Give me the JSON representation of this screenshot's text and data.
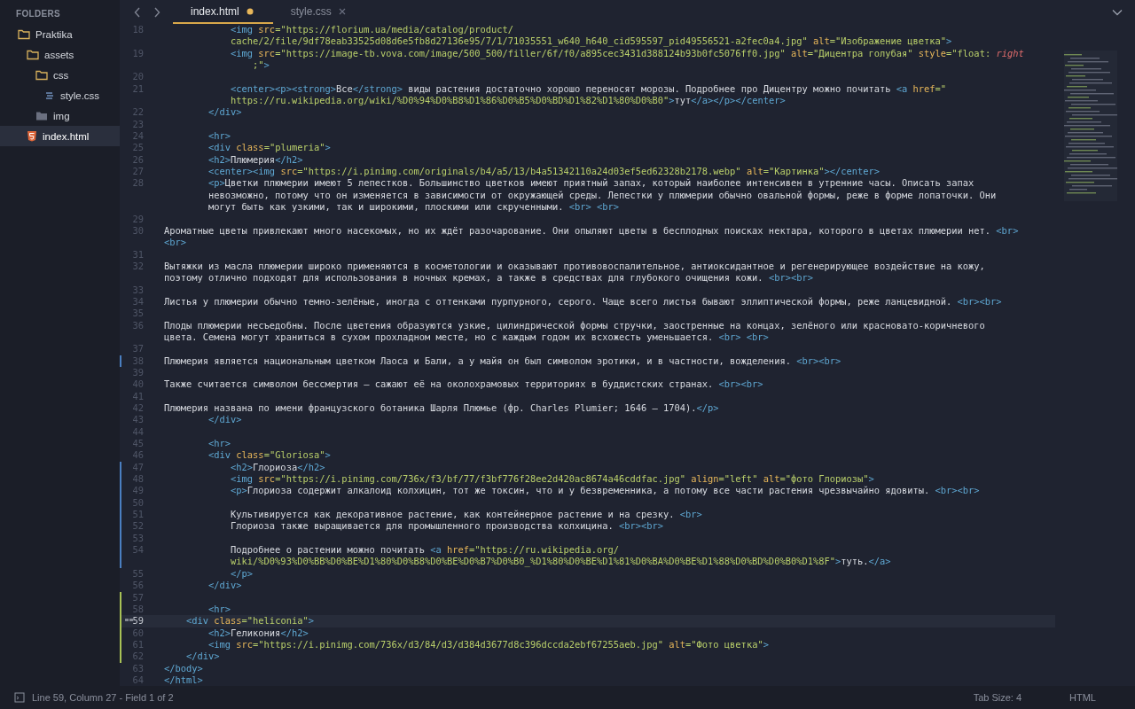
{
  "sidebar": {
    "title": "FOLDERS",
    "tree": [
      {
        "label": "Praktika",
        "kind": "folder",
        "expanded": true,
        "selected": false,
        "children": [
          {
            "label": "assets",
            "kind": "folder",
            "expanded": true,
            "selected": false,
            "children": [
              {
                "label": "css",
                "kind": "folder",
                "expanded": true,
                "selected": false,
                "children": [
                  {
                    "label": "style.css",
                    "kind": "css",
                    "selected": false
                  }
                ]
              },
              {
                "label": "img",
                "kind": "folder",
                "expanded": false,
                "selected": false
              }
            ]
          },
          {
            "label": "index.html",
            "kind": "html",
            "selected": true
          }
        ]
      }
    ]
  },
  "tabs": [
    {
      "label": "index.html",
      "selected": true,
      "modified": true
    },
    {
      "label": "style.css",
      "selected": false,
      "modified": false
    }
  ],
  "lines": [
    {
      "number": "18",
      "modified": false,
      "added": false,
      "current": false,
      "rows": [
        {
          "spans": [
            {
              "kind": "tag",
              "text": "            <img"
            },
            {
              "kind": "attr",
              "text": " src"
            },
            {
              "kind": "string",
              "text": "=\"https://florium.ua/media/catalog/product/"
            }
          ]
        },
        {
          "spans": [
            {
              "kind": "string",
              "text": "            cache/2/file/9df78eab33525d08d6e5fb8d27136e95/7/1/71035551_w640_h640_cid595597_pid49556521-a2fec0a4.jpg\""
            },
            {
              "kind": "attr",
              "text": " alt"
            },
            {
              "kind": "string",
              "text": "=\"Изображение цветка\""
            },
            {
              "kind": "tag",
              "text": ">"
            }
          ]
        }
      ]
    },
    {
      "number": "19",
      "modified": false,
      "added": false,
      "current": false,
      "rows": [
        {
          "spans": [
            {
              "kind": "tag",
              "text": "            <img"
            },
            {
              "kind": "attr",
              "text": " src"
            },
            {
              "kind": "string",
              "text": "=\"https://image-tb.vova.com/image/500_500/filler/6f/f0/a895cec3431d388124b93b0fc5076ff0.jpg\""
            },
            {
              "kind": "attr",
              "text": " alt"
            },
            {
              "kind": "string",
              "text": "=\"Дицентра голубая\""
            },
            {
              "kind": "attr",
              "text": " style"
            },
            {
              "kind": "string",
              "text": "=\"float: "
            },
            {
              "kind": "keyword",
              "text": "right"
            }
          ]
        },
        {
          "spans": [
            {
              "kind": "string",
              "text": "                ;\""
            },
            {
              "kind": "tag",
              "text": ">"
            }
          ]
        }
      ]
    },
    {
      "number": "20",
      "modified": false,
      "added": false,
      "current": false,
      "rows": [
        {
          "spans": []
        }
      ]
    },
    {
      "number": "21",
      "modified": false,
      "added": false,
      "current": false,
      "rows": [
        {
          "spans": [
            {
              "kind": "tag",
              "text": "            <center><p><strong>"
            },
            {
              "kind": "text",
              "text": "Все"
            },
            {
              "kind": "tag",
              "text": "</strong>"
            },
            {
              "kind": "text",
              "text": " виды растения достаточно хорошо переносят морозы. Подробнее про Дицентру можно почитать "
            },
            {
              "kind": "tag",
              "text": "<a"
            },
            {
              "kind": "attr",
              "text": " href"
            },
            {
              "kind": "string",
              "text": "=\""
            }
          ]
        },
        {
          "spans": [
            {
              "kind": "string",
              "text": "            https://ru.wikipedia.org/wiki/%D0%94%D0%B8%D1%86%D0%B5%D0%BD%D1%82%D1%80%D0%B0\""
            },
            {
              "kind": "tag",
              "text": ">"
            },
            {
              "kind": "text",
              "text": "тут"
            },
            {
              "kind": "tag",
              "text": "</a></p></center>"
            }
          ]
        }
      ]
    },
    {
      "number": "22",
      "modified": false,
      "added": false,
      "current": false,
      "rows": [
        {
          "spans": [
            {
              "kind": "tag",
              "text": "        </div>"
            }
          ]
        }
      ]
    },
    {
      "number": "23",
      "modified": false,
      "added": false,
      "current": false,
      "rows": [
        {
          "spans": []
        }
      ]
    },
    {
      "number": "24",
      "modified": false,
      "added": false,
      "current": false,
      "rows": [
        {
          "spans": [
            {
              "kind": "tag",
              "text": "        <hr>"
            }
          ]
        }
      ]
    },
    {
      "number": "25",
      "modified": false,
      "added": false,
      "current": false,
      "rows": [
        {
          "spans": [
            {
              "kind": "tag",
              "text": "        <div"
            },
            {
              "kind": "attr",
              "text": " class"
            },
            {
              "kind": "string",
              "text": "=\"plumeria\""
            },
            {
              "kind": "tag",
              "text": ">"
            }
          ]
        }
      ]
    },
    {
      "number": "26",
      "modified": false,
      "added": false,
      "current": false,
      "rows": [
        {
          "spans": [
            {
              "kind": "tag",
              "text": "        <h2>"
            },
            {
              "kind": "text",
              "text": "Плюмерия"
            },
            {
              "kind": "tag",
              "text": "</h2>"
            }
          ]
        }
      ]
    },
    {
      "number": "27",
      "modified": false,
      "added": false,
      "current": false,
      "rows": [
        {
          "spans": [
            {
              "kind": "tag",
              "text": "        <center><img"
            },
            {
              "kind": "attr",
              "text": " src"
            },
            {
              "kind": "string",
              "text": "=\"https://i.pinimg.com/originals/b4/a5/13/b4a51342110a24d03ef5ed62328b2178.webp\""
            },
            {
              "kind": "attr",
              "text": " alt"
            },
            {
              "kind": "string",
              "text": "=\"Картинка\""
            },
            {
              "kind": "tag",
              "text": "></center>"
            }
          ]
        }
      ]
    },
    {
      "number": "28",
      "modified": false,
      "added": false,
      "current": false,
      "rows": [
        {
          "spans": [
            {
              "kind": "tag",
              "text": "        <p>"
            },
            {
              "kind": "text",
              "text": "Цветки плюмерии имеют 5 лепестков. Большинство цветков имеют приятный запах, который наиболее интенсивен в утренние часы. Описать запах"
            }
          ]
        },
        {
          "spans": [
            {
              "kind": "text",
              "text": "        невозможно, потому что он изменяется в зависимости от окружающей среды. Лепестки у плюмерии обычно овальной формы, реже в форме лопаточки. Они"
            }
          ]
        },
        {
          "spans": [
            {
              "kind": "text",
              "text": "        могут быть как узкими, так и широкими, плоскими или скрученными. "
            },
            {
              "kind": "tag",
              "text": "<br> <br>"
            }
          ]
        }
      ]
    },
    {
      "number": "29",
      "modified": false,
      "added": false,
      "current": false,
      "rows": [
        {
          "spans": []
        }
      ]
    },
    {
      "number": "30",
      "modified": false,
      "added": false,
      "current": false,
      "rows": [
        {
          "spans": [
            {
              "kind": "text",
              "text": "Ароматные цветы привлекают много насекомых, но их ждёт разочарование. Они опыляют цветы в бесплодных поисках нектара, которого в цветах плюмерии нет. "
            },
            {
              "kind": "tag",
              "text": "<br>"
            }
          ]
        },
        {
          "spans": [
            {
              "kind": "tag",
              "text": "<br>"
            }
          ]
        }
      ]
    },
    {
      "number": "31",
      "modified": false,
      "added": false,
      "current": false,
      "rows": [
        {
          "spans": []
        }
      ]
    },
    {
      "number": "32",
      "modified": false,
      "added": false,
      "current": false,
      "rows": [
        {
          "spans": [
            {
              "kind": "text",
              "text": "Вытяжки из масла плюмерии широко применяются в косметологии и оказывают противовоспалительное, антиоксидантное и регенерирующее воздействие на кожу,"
            }
          ]
        },
        {
          "spans": [
            {
              "kind": "text",
              "text": "поэтому отлично подходят для использования в ночных кремах, а также в средствах для глубокого очищения кожи. "
            },
            {
              "kind": "tag",
              "text": "<br><br>"
            }
          ]
        }
      ]
    },
    {
      "number": "33",
      "modified": false,
      "added": false,
      "current": false,
      "rows": [
        {
          "spans": []
        }
      ]
    },
    {
      "number": "34",
      "modified": false,
      "added": false,
      "current": false,
      "rows": [
        {
          "spans": [
            {
              "kind": "text",
              "text": "Листья у плюмерии обычно темно-зелёные, иногда с оттенками пурпурного, серого. Чаще всего листья бывают эллиптической формы, реже ланцевидной. "
            },
            {
              "kind": "tag",
              "text": "<br><br>"
            }
          ]
        }
      ]
    },
    {
      "number": "35",
      "modified": false,
      "added": false,
      "current": false,
      "rows": [
        {
          "spans": []
        }
      ]
    },
    {
      "number": "36",
      "modified": false,
      "added": false,
      "current": false,
      "rows": [
        {
          "spans": [
            {
              "kind": "text",
              "text": "Плоды плюмерии несъедобны. После цветения образуются узкие, цилиндрической формы стручки, заостренные на концах, зелёного или красновато-коричневого"
            }
          ]
        },
        {
          "spans": [
            {
              "kind": "text",
              "text": "цвета. Семена могут храниться в сухом прохладном месте, но с каждым годом их всхожесть уменьшается. "
            },
            {
              "kind": "tag",
              "text": "<br> <br>"
            }
          ]
        }
      ]
    },
    {
      "number": "37",
      "modified": false,
      "added": false,
      "current": false,
      "rows": [
        {
          "spans": []
        }
      ]
    },
    {
      "number": "38",
      "modified": true,
      "added": false,
      "current": false,
      "rows": [
        {
          "spans": [
            {
              "kind": "text",
              "text": "Плюмерия является национальным цветком Лаоса и Бали, а у майя он был символом эротики, и в частности, вожделения. "
            },
            {
              "kind": "tag",
              "text": "<br><br>"
            }
          ]
        }
      ]
    },
    {
      "number": "39",
      "modified": false,
      "added": false,
      "current": false,
      "rows": [
        {
          "spans": []
        }
      ]
    },
    {
      "number": "40",
      "modified": false,
      "added": false,
      "current": false,
      "rows": [
        {
          "spans": [
            {
              "kind": "text",
              "text": "Также считается символом бессмертия — сажают её на околохрамовых территориях в буддистских странах. "
            },
            {
              "kind": "tag",
              "text": "<br><br>"
            }
          ]
        }
      ]
    },
    {
      "number": "41",
      "modified": false,
      "added": false,
      "current": false,
      "rows": [
        {
          "spans": []
        }
      ]
    },
    {
      "number": "42",
      "modified": false,
      "added": false,
      "current": false,
      "rows": [
        {
          "spans": [
            {
              "kind": "text",
              "text": "Плюмерия названа по имени французского ботаника Шарля Плюмье (фр. Charles Plumier; 1646 — 1704)."
            },
            {
              "kind": "tag",
              "text": "</p>"
            }
          ]
        }
      ]
    },
    {
      "number": "43",
      "modified": false,
      "added": false,
      "current": false,
      "rows": [
        {
          "spans": [
            {
              "kind": "tag",
              "text": "        </div>"
            }
          ]
        }
      ]
    },
    {
      "number": "44",
      "modified": false,
      "added": false,
      "current": false,
      "rows": [
        {
          "spans": []
        }
      ]
    },
    {
      "number": "45",
      "modified": false,
      "added": false,
      "current": false,
      "rows": [
        {
          "spans": [
            {
              "kind": "tag",
              "text": "        <hr>"
            }
          ]
        }
      ]
    },
    {
      "number": "46",
      "modified": false,
      "added": false,
      "current": false,
      "rows": [
        {
          "spans": [
            {
              "kind": "tag",
              "text": "        <div"
            },
            {
              "kind": "attr",
              "text": " class"
            },
            {
              "kind": "string",
              "text": "=\"Gloriosa\""
            },
            {
              "kind": "tag",
              "text": ">"
            }
          ]
        }
      ]
    },
    {
      "number": "47",
      "modified": true,
      "added": false,
      "current": false,
      "rows": [
        {
          "spans": [
            {
              "kind": "tag",
              "text": "            <h2>"
            },
            {
              "kind": "text",
              "text": "Глориоза"
            },
            {
              "kind": "tag",
              "text": "</h2>"
            }
          ]
        }
      ]
    },
    {
      "number": "48",
      "modified": true,
      "added": false,
      "current": false,
      "rows": [
        {
          "spans": [
            {
              "kind": "tag",
              "text": "            <img"
            },
            {
              "kind": "attr",
              "text": " src"
            },
            {
              "kind": "string",
              "text": "=\"https://i.pinimg.com/736x/f3/bf/77/f3bf776f28ee2d420ac8674a46cddfac.jpg\""
            },
            {
              "kind": "attr",
              "text": " align"
            },
            {
              "kind": "string",
              "text": "=\"left\""
            },
            {
              "kind": "attr",
              "text": " alt"
            },
            {
              "kind": "string",
              "text": "=\"фото Глориозы\""
            },
            {
              "kind": "tag",
              "text": ">"
            }
          ]
        }
      ]
    },
    {
      "number": "49",
      "modified": true,
      "added": false,
      "current": false,
      "rows": [
        {
          "spans": [
            {
              "kind": "tag",
              "text": "            <p>"
            },
            {
              "kind": "text",
              "text": "Глориоза содержит алкалоид колхицин, тот же токсин, что и у безвременника, а потому все части растения чрезвычайно ядовиты. "
            },
            {
              "kind": "tag",
              "text": "<br><br>"
            }
          ]
        }
      ]
    },
    {
      "number": "50",
      "modified": true,
      "added": false,
      "current": false,
      "rows": [
        {
          "spans": []
        }
      ]
    },
    {
      "number": "51",
      "modified": true,
      "added": false,
      "current": false,
      "rows": [
        {
          "spans": [
            {
              "kind": "text",
              "text": "            Культивируется как декоративное растение, как контейнерное растение и на срезку. "
            },
            {
              "kind": "tag",
              "text": "<br>"
            }
          ]
        }
      ]
    },
    {
      "number": "52",
      "modified": true,
      "added": false,
      "current": false,
      "rows": [
        {
          "spans": [
            {
              "kind": "text",
              "text": "            Глориоза также выращивается для промышленного производства колхицина. "
            },
            {
              "kind": "tag",
              "text": "<br><br>"
            }
          ]
        }
      ]
    },
    {
      "number": "53",
      "modified": true,
      "added": false,
      "current": false,
      "rows": [
        {
          "spans": []
        }
      ]
    },
    {
      "number": "54",
      "modified": true,
      "added": false,
      "current": false,
      "rows": [
        {
          "spans": [
            {
              "kind": "text",
              "text": "            Подробнее о растении можно почитать "
            },
            {
              "kind": "tag",
              "text": "<a"
            },
            {
              "kind": "attr",
              "text": " href"
            },
            {
              "kind": "string",
              "text": "=\"https://ru.wikipedia.org/"
            }
          ]
        },
        {
          "spans": [
            {
              "kind": "string",
              "text": "            wiki/%D0%93%D0%BB%D0%BE%D1%80%D0%B8%D0%BE%D0%B7%D0%B0_%D1%80%D0%BE%D1%81%D0%BA%D0%BE%D1%88%D0%BD%D0%B0%D1%8F\""
            },
            {
              "kind": "tag",
              "text": ">"
            },
            {
              "kind": "text",
              "text": "туть."
            },
            {
              "kind": "tag",
              "text": "</a>"
            }
          ]
        }
      ]
    },
    {
      "number": "55",
      "modified": false,
      "added": false,
      "current": false,
      "rows": [
        {
          "spans": [
            {
              "kind": "tag",
              "text": "            </p>"
            }
          ]
        }
      ]
    },
    {
      "number": "56",
      "modified": false,
      "added": false,
      "current": false,
      "rows": [
        {
          "spans": [
            {
              "kind": "tag",
              "text": "        </div>"
            }
          ]
        }
      ]
    },
    {
      "number": "57",
      "modified": false,
      "added": true,
      "current": false,
      "rows": [
        {
          "spans": []
        }
      ]
    },
    {
      "number": "58",
      "modified": false,
      "added": true,
      "current": false,
      "rows": [
        {
          "spans": [
            {
              "kind": "tag",
              "text": "        <hr>"
            }
          ]
        }
      ]
    },
    {
      "number": "59",
      "modified": false,
      "added": true,
      "current": true,
      "bookmark": true,
      "rows": [
        {
          "spans": [
            {
              "kind": "tag",
              "text": "    <div"
            },
            {
              "kind": "attr",
              "text": " class"
            },
            {
              "kind": "string",
              "text": "=\"heliconia\""
            },
            {
              "kind": "tag",
              "text": ">"
            }
          ]
        }
      ]
    },
    {
      "number": "60",
      "modified": false,
      "added": true,
      "current": false,
      "rows": [
        {
          "spans": [
            {
              "kind": "tag",
              "text": "        <h2>"
            },
            {
              "kind": "text",
              "text": "Геликония"
            },
            {
              "kind": "tag",
              "text": "</h2>"
            }
          ]
        }
      ]
    },
    {
      "number": "61",
      "modified": false,
      "added": true,
      "current": false,
      "rows": [
        {
          "spans": [
            {
              "kind": "tag",
              "text": "        <img"
            },
            {
              "kind": "attr",
              "text": " src"
            },
            {
              "kind": "string",
              "text": "=\"https://i.pinimg.com/736x/d3/84/d3/d384d3677d8c396dccda2ebf67255aeb.jpg\""
            },
            {
              "kind": "attr",
              "text": " alt"
            },
            {
              "kind": "string",
              "text": "=\"Фото цветка\""
            },
            {
              "kind": "tag",
              "text": ">"
            }
          ]
        }
      ]
    },
    {
      "number": "62",
      "modified": false,
      "added": true,
      "current": false,
      "rows": [
        {
          "spans": [
            {
              "kind": "tag",
              "text": "    </div>"
            }
          ]
        }
      ]
    },
    {
      "number": "63",
      "modified": false,
      "added": false,
      "current": false,
      "rows": [
        {
          "spans": [
            {
              "kind": "tag",
              "text": "</body>"
            }
          ]
        }
      ]
    },
    {
      "number": "64",
      "modified": false,
      "added": false,
      "current": false,
      "rows": [
        {
          "spans": [
            {
              "kind": "tag",
              "text": "</html>"
            }
          ]
        }
      ]
    }
  ],
  "status_bar": {
    "position": "Line 59, Column 27 - Field 1 of 2",
    "tab_size": "Tab Size: 4",
    "syntax": "HTML"
  }
}
